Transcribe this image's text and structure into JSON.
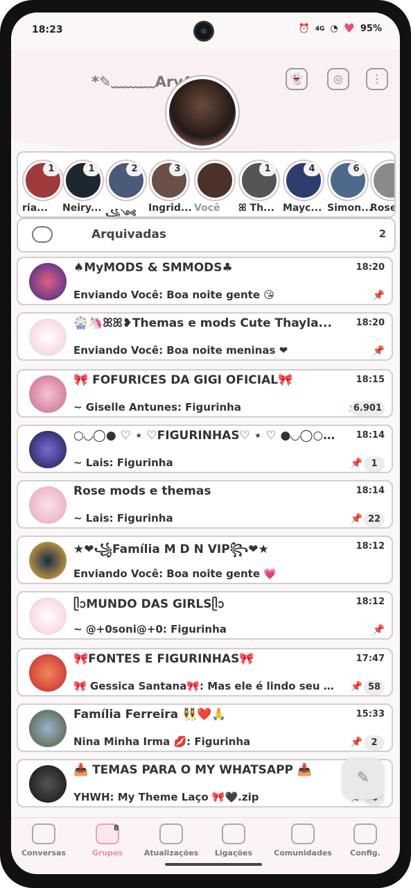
{
  "status": {
    "time": "18:23",
    "network": "4G",
    "battery": "95%"
  },
  "profile": {
    "name": "*✎﹏﹏﹏Ary❥"
  },
  "stories": [
    {
      "name": "ria...",
      "count": "1"
    },
    {
      "name": "Neiry...",
      "count": "1"
    },
    {
      "name": "꧁༺",
      "count": "2"
    },
    {
      "name": "Ingrid...",
      "count": "3"
    },
    {
      "name": "Você",
      "count": ""
    },
    {
      "name": "ꕤ Th...",
      "count": "1"
    },
    {
      "name": "Mayc...",
      "count": "4"
    },
    {
      "name": "Simon...",
      "count": "6"
    },
    {
      "name": "Rose",
      "count": ""
    }
  ],
  "archived": {
    "label": "Arquivadas",
    "count": "2"
  },
  "chats": [
    {
      "title": "♠MyMODS & SMMODS♣",
      "time": "18:20",
      "msg": "Enviando Você: Boa noite gente 😘",
      "unread": ""
    },
    {
      "title": "🎡🦄ꕤꕤ❥Themas e mods Cute Thayla...",
      "time": "18:20",
      "msg": "Enviando Você: Boa noite meninas ❤",
      "unread": ""
    },
    {
      "title": "🎀 FOFURICES DA GIGI OFICIAL🎀",
      "time": "18:15",
      "msg": "~ Giselle Antunes: Figurinha",
      "unread": "6.901"
    },
    {
      "title": "○◡◯● ♡ ⋆ ♡FIGURINHAS♡ ⋆ ♡ ●◡◯○ B...",
      "time": "18:14",
      "msg": "~ Lais: Figurinha",
      "unread": "1"
    },
    {
      "title": "Rose mods e themas",
      "time": "18:14",
      "msg": "~ Lais: Figurinha",
      "unread": "22"
    },
    {
      "title": "★❤꧁Família M D N VIP꧂❤★",
      "time": "18:12",
      "msg": "Enviando Você: Boa noite gente 💗",
      "unread": ""
    },
    {
      "title": "ᥫᩣMUNDO DAS GIRLSᥫᩣ",
      "time": "18:12",
      "msg": "~ @+0soni@+0: Figurinha",
      "unread": ""
    },
    {
      "title": "🎀FONTES E FIGURINHAS🎀",
      "time": "17:47",
      "msg": "🎀 Gessica Santana🎀: Mas ele é lindo seu mod",
      "unread": "58"
    },
    {
      "title": "Família Ferreira 👯‍♀️❤️🙏",
      "time": "15:33",
      "msg": "Nina Minha Irma 💋: Figurinha",
      "unread": "2"
    },
    {
      "title": "📥 TEMAS PARA O MY WHATSAPP 📥",
      "time": "",
      "msg": "YHWH: My Theme Laço 🎀🖤.zip",
      "unread": "4"
    }
  ],
  "nav": [
    {
      "label": "Conversas"
    },
    {
      "label": "Grupos",
      "badge": "8"
    },
    {
      "label": "Atualizações"
    },
    {
      "label": "Ligações"
    },
    {
      "label": "Comunidades"
    },
    {
      "label": "Config."
    }
  ],
  "colors": {
    "accent": "#e58fa8",
    "background": "#fbf6f7"
  }
}
